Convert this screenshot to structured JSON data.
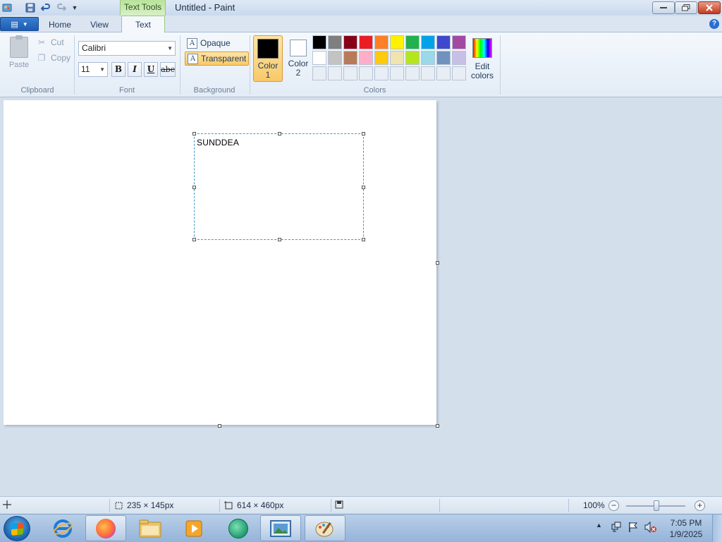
{
  "window": {
    "title": "Untitled - Paint",
    "context_tab": "Text Tools"
  },
  "quick_access": {
    "icons": [
      "paint-app-icon",
      "save-icon",
      "undo-icon",
      "redo-icon",
      "customize-dropdown-icon"
    ]
  },
  "tabs": {
    "home": "Home",
    "view": "View",
    "text": "Text"
  },
  "clipboard": {
    "paste": "Paste",
    "cut": "Cut",
    "copy": "Copy",
    "label": "Clipboard"
  },
  "font": {
    "family": "Calibri",
    "size": "11",
    "bold": "B",
    "italic": "I",
    "underline": "U",
    "strikethrough": "abc",
    "label": "Font"
  },
  "background": {
    "opaque": "Opaque",
    "transparent": "Transparent",
    "selected": "Transparent",
    "label": "Background"
  },
  "colors": {
    "color1_label": "Color 1",
    "color1_label_a": "Color",
    "color1_label_b": "1",
    "color2_label_a": "Color",
    "color2_label_b": "2",
    "color1_value": "#000000",
    "color2_value": "#ffffff",
    "edit_a": "Edit",
    "edit_b": "colors",
    "label": "Colors",
    "palette_row1": [
      "#000000",
      "#7f7f7f",
      "#880015",
      "#ed1c24",
      "#ff7f27",
      "#fff200",
      "#22b14c",
      "#00a2e8",
      "#3f48cc",
      "#a349a4"
    ],
    "palette_row2": [
      "#ffffff",
      "#c3c3c3",
      "#b97a57",
      "#ffaec9",
      "#ffc90e",
      "#efe4b0",
      "#b5e61d",
      "#99d9ea",
      "#7092be",
      "#c8bfe7"
    ],
    "palette_row3_empty": 10
  },
  "canvas": {
    "text": "SUNDDEA"
  },
  "status": {
    "selection_size": "235 × 145px",
    "image_size": "614 × 460px",
    "zoom": "100%"
  },
  "taskbar": {
    "apps": [
      "internet-explorer-icon",
      "firefox-icon",
      "file-explorer-icon",
      "media-player-icon",
      "media-center-icon",
      "photo-viewer-icon",
      "paint-icon"
    ],
    "time": "7:05 PM",
    "date": "1/9/2025"
  }
}
